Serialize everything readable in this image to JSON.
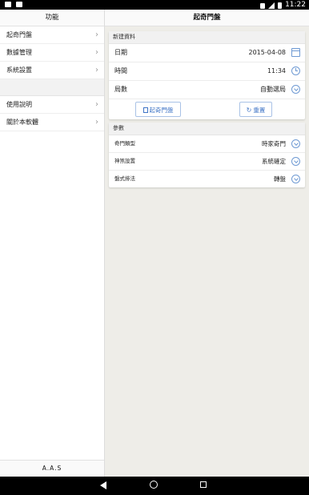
{
  "status_bar": {
    "time": "11:22"
  },
  "sidebar": {
    "title": "功能",
    "items": [
      {
        "label": "起奇門盤"
      },
      {
        "label": "數據管理"
      },
      {
        "label": "系統設置"
      }
    ],
    "items2": [
      {
        "label": "使用說明"
      },
      {
        "label": "關於本軟體"
      }
    ],
    "footer": "A.A.S"
  },
  "main": {
    "title": "起奇門盤",
    "new_card": {
      "title": "新建資料",
      "rows": [
        {
          "label": "日期",
          "value": "2015-04-08",
          "icon": "calendar-icon"
        },
        {
          "label": "時間",
          "value": "11:34",
          "icon": "clock-icon"
        },
        {
          "label": "局數",
          "value": "自動選局",
          "icon": "chevron-down-icon"
        }
      ],
      "buttons": {
        "start": "起奇門盤",
        "reset": "重置"
      }
    },
    "params_card": {
      "title": "參數",
      "rows": [
        {
          "label": "奇門類型",
          "value": "時家奇門"
        },
        {
          "label": "神煞設置",
          "value": "系統確定"
        },
        {
          "label": "盤式排法",
          "value": "轉盤"
        }
      ]
    }
  },
  "colors": {
    "accent": "#3f74c6",
    "icon": "#6f9ad3"
  }
}
